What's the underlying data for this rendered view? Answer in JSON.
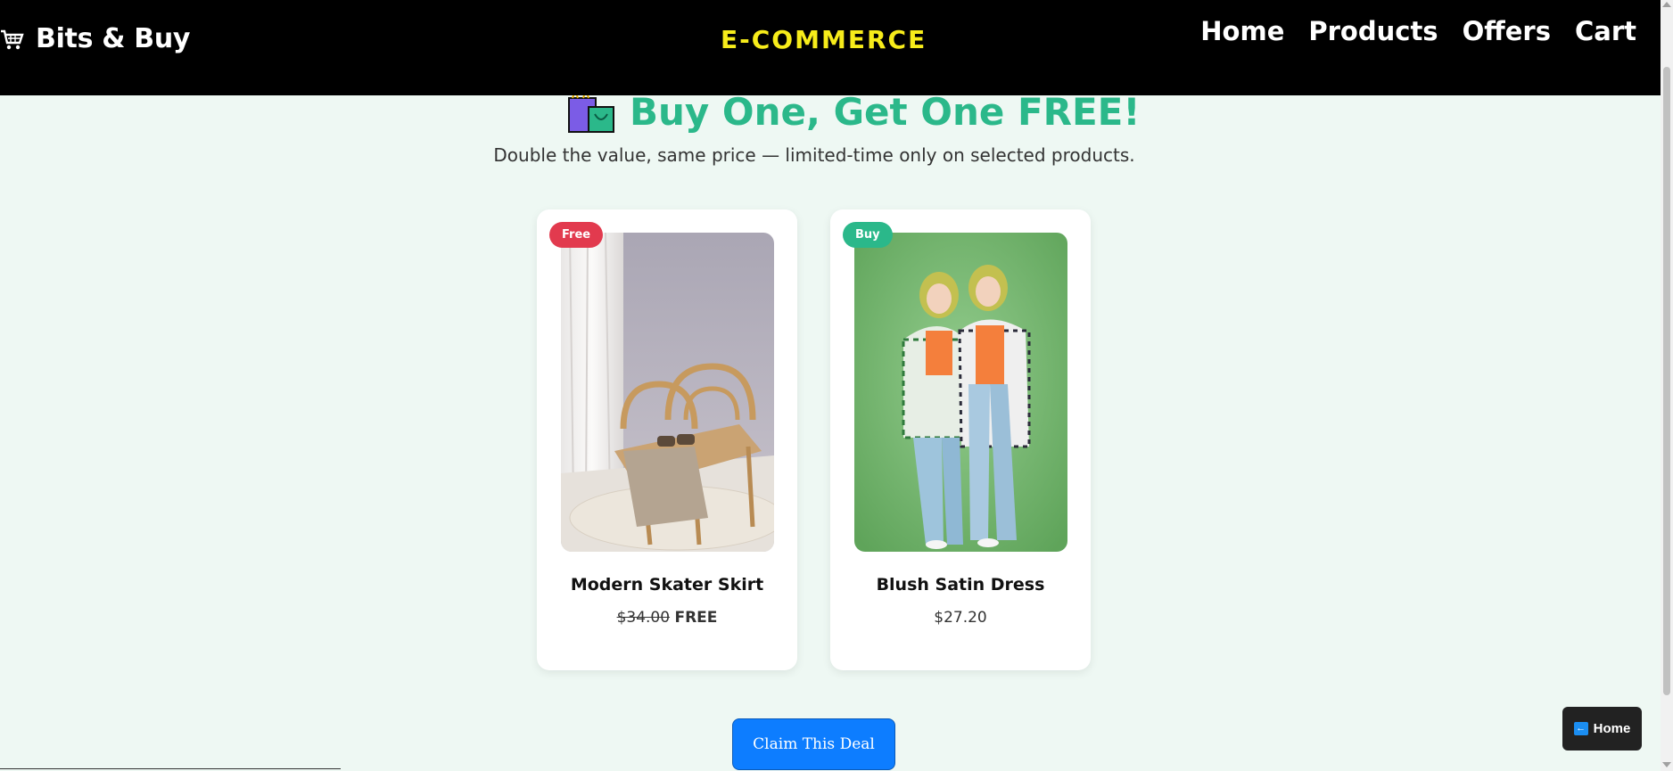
{
  "header": {
    "brand": "Bits & Buy",
    "center_title": "E-COMMERCE",
    "nav": [
      "Home",
      "Products",
      "Offers",
      "Cart"
    ]
  },
  "hero": {
    "title": "Buy One, Get One FREE!",
    "subtitle": "Double the value, same price — limited-time only on selected products."
  },
  "products": [
    {
      "badge": "Free",
      "name": "Modern Skater Skirt",
      "old_price": "$34.00",
      "price": "FREE"
    },
    {
      "badge": "Buy",
      "name": "Blush Satin Dress",
      "price": "$27.20"
    }
  ],
  "claim_button": "Claim This Deal",
  "home_button": "Home",
  "colors": {
    "accent_green": "#2bb88a",
    "badge_red": "#e23a4e",
    "claim_blue": "#0d7dff",
    "title_yellow": "#f7ec1a",
    "page_bg": "#eef8f3"
  }
}
